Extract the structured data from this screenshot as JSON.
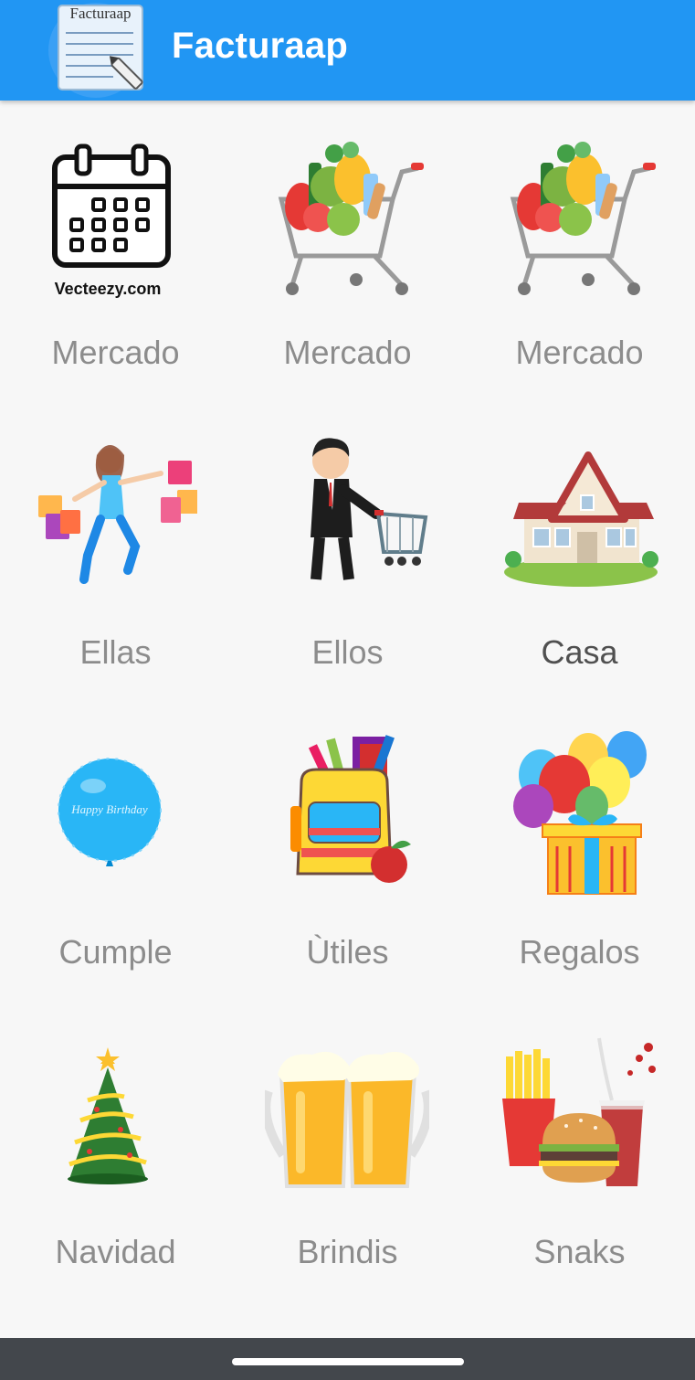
{
  "app": {
    "title": "Facturaap",
    "logo_text": "Facturaap"
  },
  "tiles": [
    {
      "label": "Mercado",
      "icon": "calendar-icon",
      "icon_caption": "Vecteezy.com"
    },
    {
      "label": "Mercado",
      "icon": "shopping-cart-groceries-icon"
    },
    {
      "label": "Mercado",
      "icon": "shopping-cart-groceries-icon"
    },
    {
      "label": "Ellas",
      "icon": "woman-shopping-bags-icon"
    },
    {
      "label": "Ellos",
      "icon": "man-with-cart-icon"
    },
    {
      "label": "Casa",
      "icon": "house-icon"
    },
    {
      "label": "Cumple",
      "icon": "birthday-balloon-icon",
      "icon_caption": "Happy Birthday"
    },
    {
      "label": "Ùtiles",
      "icon": "school-backpack-icon"
    },
    {
      "label": "Regalos",
      "icon": "gift-balloons-icon"
    },
    {
      "label": "Navidad",
      "icon": "christmas-tree-icon"
    },
    {
      "label": "Brindis",
      "icon": "beer-mugs-icon"
    },
    {
      "label": "Snaks",
      "icon": "fast-food-icon"
    }
  ],
  "colors": {
    "appbar": "#2196f3",
    "background": "#f7f7f7",
    "label": "#8c8c8c",
    "navbar": "#43474c"
  }
}
